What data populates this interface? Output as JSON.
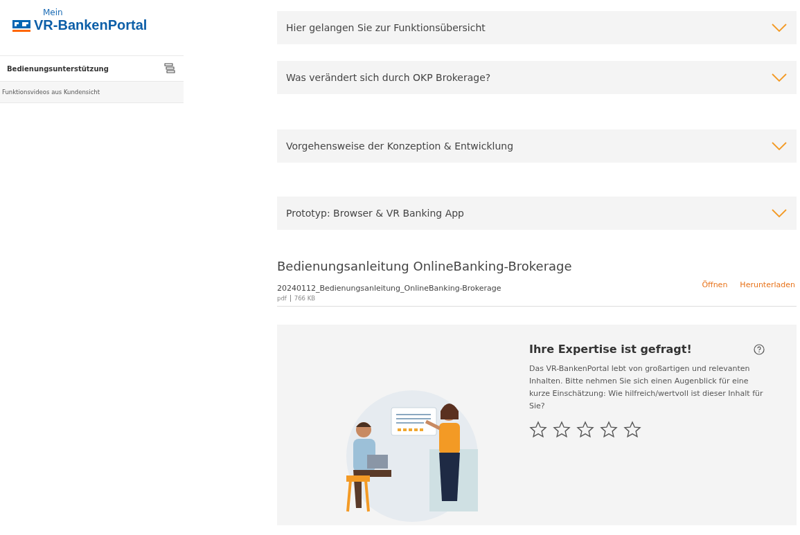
{
  "logo": {
    "prefix": "Mein",
    "name": "VR-BankenPortal"
  },
  "sidebar": {
    "items": [
      {
        "label": "Bedienungsunterstützung",
        "kind": "header"
      },
      {
        "label": "Funktionsvideos aus Kundensicht",
        "kind": "link"
      }
    ]
  },
  "accordions": [
    {
      "title": "Hier gelangen Sie zur Funktionsübersicht",
      "expanded": false
    },
    {
      "title": "Was verändert sich durch OKP Brokerage?",
      "expanded": false
    },
    {
      "title": "Vorgehensweise der Konzeption & Entwicklung",
      "expanded": false
    },
    {
      "title": "Prototyp: Browser & VR Banking App",
      "expanded": false
    }
  ],
  "document_section": {
    "title": "Bedienungsanleitung OnlineBanking-Brokerage",
    "file": {
      "name": "20240112_Bedienungsanleitung_OnlineBanking-Brokerage",
      "type": "pdf",
      "size": "766 KB",
      "actions": [
        "Öffnen",
        "Herunterladen"
      ]
    }
  },
  "feedback": {
    "title": "Ihre Expertise ist gefragt!",
    "text": "Das VR-BankenPortal lebt von großartigen und relevanten Inhalten. Bitte nehmen Sie sich einen Augenblick für eine kurze Einschätzung: Wie hilfreich/wertvoll ist dieser Inhalt für Sie?",
    "stars": 0
  }
}
